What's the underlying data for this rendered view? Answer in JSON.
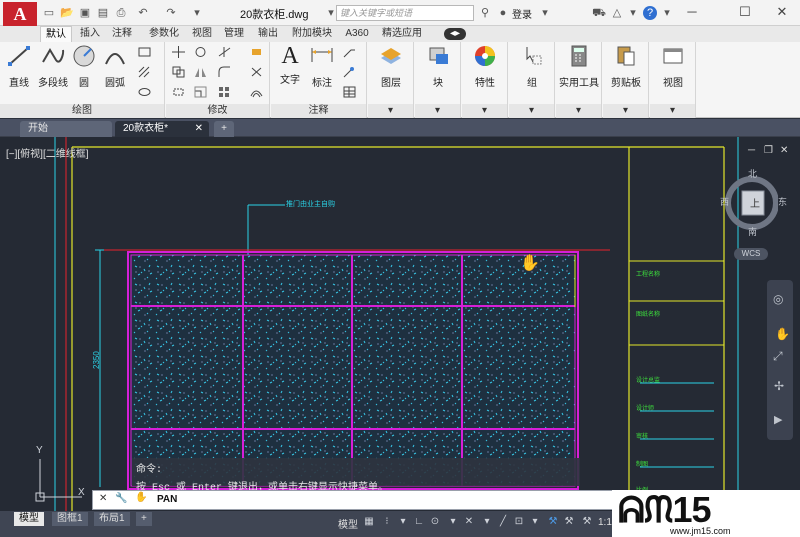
{
  "app": {
    "logo_letter": "A",
    "doc_title": "20款衣柜.dwg",
    "search_placeholder": "键入关键字或短语",
    "login": "登录",
    "help": "?"
  },
  "ribbon_tabs": [
    "默认",
    "插入",
    "注释",
    "参数化",
    "视图",
    "管理",
    "输出",
    "附加模块",
    "A360",
    "精选应用"
  ],
  "ribbon": {
    "draw_tools": [
      "直线",
      "多段线",
      "圆",
      "圆弧"
    ],
    "panels": {
      "draw": "绘图",
      "modify": "修改",
      "annotation": "注释"
    },
    "annotation_tools": [
      "文字",
      "标注"
    ],
    "big_buttons": [
      "图层",
      "块",
      "特性",
      "组",
      "实用工具",
      "剪贴板",
      "视图"
    ]
  },
  "doc_tabs": [
    "开始",
    "20款衣柜*"
  ],
  "viewport": {
    "label": "[−][俯视][二维线框]"
  },
  "navcube": {
    "north": "北",
    "south": "南",
    "east": "东",
    "west": "西",
    "face": "上",
    "wcs": "WCS"
  },
  "drawing": {
    "leader_text": "推门由业主自购",
    "dim_text": "2350",
    "title_block": [
      "工程名称",
      "图纸名称",
      "设计总监",
      "设计师",
      "审核",
      "制图",
      "比例"
    ]
  },
  "command": {
    "history_label": "命令:",
    "prompt": "按 Esc 或 Enter 键退出，或单击右键显示快捷菜单。",
    "input": "PAN"
  },
  "status": {
    "layout_tabs": [
      "模型",
      "图框1",
      "布局1"
    ],
    "model_label": "模型",
    "scale": "1:1"
  },
  "watermark": {
    "text": "jm15",
    "url": "www.jm15.com"
  },
  "colors": {
    "accent": "#c8232c",
    "canvas": "#252a34",
    "magenta": "#d61fd8",
    "yellow": "#e3e62a",
    "cyan": "#2ad2e6",
    "red": "#e8232c"
  }
}
